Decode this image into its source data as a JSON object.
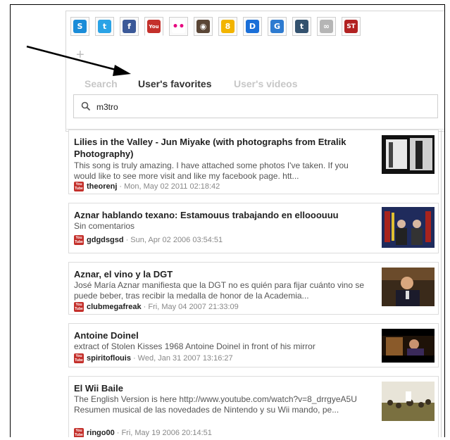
{
  "services": [
    {
      "name": "skype-icon",
      "glyph": "S",
      "color": "#1a8cd8",
      "active": false
    },
    {
      "name": "twitter-icon",
      "glyph": "t",
      "color": "#2aa3e6",
      "active": false
    },
    {
      "name": "facebook-icon",
      "glyph": "f",
      "color": "#3b5998",
      "active": false
    },
    {
      "name": "youtube-icon",
      "glyph": "You",
      "color": "#c4302b",
      "active": true
    },
    {
      "name": "flickr-icon",
      "glyph": "••",
      "color": "#ffffff",
      "active": false
    },
    {
      "name": "instagram-icon",
      "glyph": "◉",
      "color": "#5a4636",
      "active": false
    },
    {
      "name": "google-icon",
      "glyph": "8",
      "color": "#f2b400",
      "active": false
    },
    {
      "name": "dailymotion-icon",
      "glyph": "D",
      "color": "#1a6fd8",
      "active": false
    },
    {
      "name": "g-icon",
      "glyph": "G",
      "color": "#2e7bd0",
      "active": false
    },
    {
      "name": "tumblr-icon",
      "glyph": "t",
      "color": "#34526f",
      "active": false
    },
    {
      "name": "link-icon",
      "glyph": "∞",
      "color": "#b5b5b5",
      "active": false
    },
    {
      "name": "st-icon",
      "glyph": "ST",
      "color": "#b22222",
      "active": false
    }
  ],
  "tabs": {
    "search": "Search",
    "favorites": "User's favorites",
    "videos": "User's videos"
  },
  "search": {
    "value": "m3tro"
  },
  "results": [
    {
      "title": "Lilies in the Valley - Jun Miyake (with photographs from Etralik Photography)",
      "description": "This song is truly amazing. I have attached some photos I've taken. If you would like to see more visit and like my facebook page. htt...",
      "user": "theorenj",
      "date": "· Mon, May 02 2011 02:18:42"
    },
    {
      "title": "Aznar hablando texano: Estamouus trabajando en ellooouuu",
      "description": "Sin comentarios",
      "user": "gdgdsgsd",
      "date": "· Sun, Apr 02 2006 03:54:51"
    },
    {
      "title": "Aznar, el vino y la DGT",
      "description": "José María Aznar manifiesta que la DGT no es quién para fijar cuánto vino se puede beber, tras recibir la medalla de honor de la Academia...",
      "user": "clubmegafreak",
      "date": "· Fri, May 04 2007 21:33:09"
    },
    {
      "title": "Antoine Doinel",
      "description": "extract of Stolen Kisses 1968 Antoine Doinel in front of his mirror",
      "user": "spiritoflouis",
      "date": "· Wed, Jan 31 2007 13:16:27"
    },
    {
      "title": "El Wii Baile",
      "description": "The English Version is here http://www.youtube.com/watch?v=8_drrgyeA5U Resumen musical de las novedades de Nintendo y su Wii mando, pe...",
      "user": "ringo00",
      "date": "· Fri, May 19 2006 20:14:51"
    }
  ]
}
